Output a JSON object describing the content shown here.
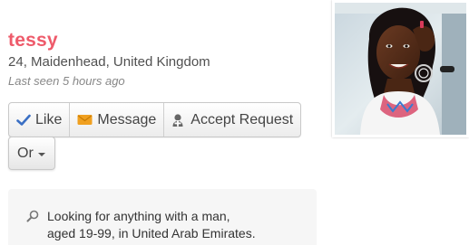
{
  "profile": {
    "name": "tessy",
    "age": "24",
    "location": "Maidenhead, United Kingdom",
    "last_seen": "Last seen 5 hours ago"
  },
  "actions": {
    "like_label": "Like",
    "message_label": "Message",
    "accept_label": "Accept Request",
    "or_label": "Or"
  },
  "looking_for": {
    "line1": "Looking for anything with a man,",
    "line2": "aged 19-99, in United Arab Emirates."
  },
  "icons": {
    "like": "check-icon",
    "message": "envelope-icon",
    "accept": "user-add-icon",
    "or": "caret-down-icon",
    "looking": "search-icon"
  },
  "colors": {
    "name": "#ee5a6a",
    "check": "#3a6fc4",
    "envelope": "#f0a020"
  }
}
